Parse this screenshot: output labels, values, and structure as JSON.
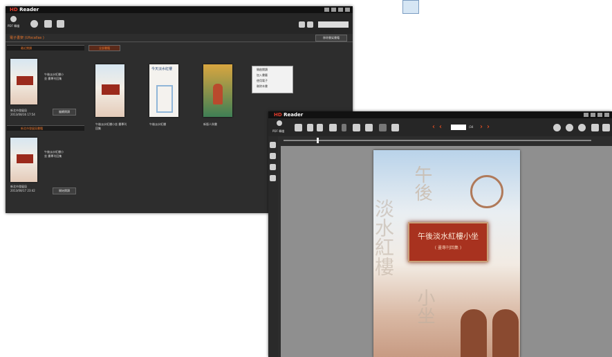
{
  "library": {
    "app_name": "Reader",
    "toolbar_label": "PDF 轉檔",
    "sort_label": "依日期排序",
    "section_title": "電子書架 (Ufocallas )",
    "top_right_button": "移除書架書籍",
    "tabs": [
      "最近閱讀",
      "全部書籍"
    ],
    "featured": [
      {
        "title_line1": "午後淡水紅樓小",
        "title_line2": "坐 畫專刊回集",
        "date": "新北市發展局",
        "meta": "2013/08/16 17:54",
        "button": "繼續閱讀"
      },
      {
        "title_line1": "午後淡水紅樓小",
        "title_line2": "坐 畫專刊回集",
        "date": "新北市發展局",
        "meta": "2013/08/17 23:42",
        "button": "開始閱讀"
      }
    ],
    "second_section": "新北市發展局書籍",
    "books": [
      {
        "caption": "午後淡水紅樓小坐 畫專刊回集"
      },
      {
        "caption": "午後淡水紅樓",
        "cover_title": "今天淡水紅樓"
      },
      {
        "caption": "新版人與書"
      }
    ],
    "context_menu": [
      "開啟閱讀",
      "加入書籤",
      "使用電子",
      "刪除本書"
    ]
  },
  "reader": {
    "app_name": "Reader",
    "toolbar_label": "PDF 轉檔",
    "page_value": "",
    "page_total": "/34",
    "cover": {
      "title": "午後淡水紅樓小坐",
      "subtitle": "( 畫專刊回集 )",
      "vertical_left": "淡水紅樓",
      "vertical_top": "午後",
      "vertical_right": "小坐"
    },
    "colors": {
      "nav_arrows": "#ff5522",
      "bg_window": "#2d2d2d",
      "page_area": "#9d9d9d"
    }
  },
  "icons": {
    "floating": "broken-image-icon"
  }
}
